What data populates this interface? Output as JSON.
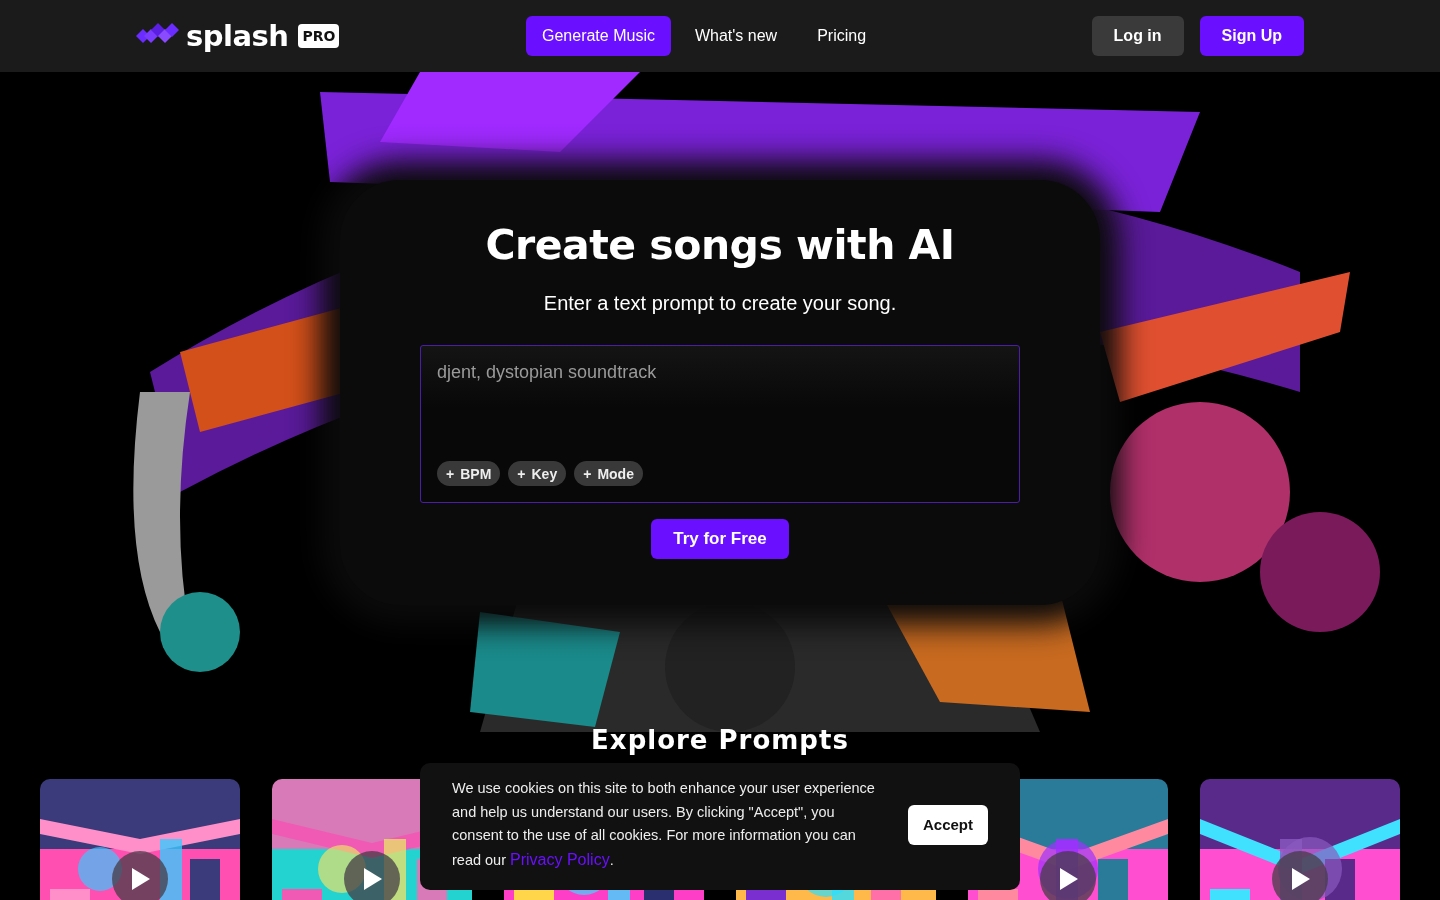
{
  "nav": {
    "logo_text": "splash",
    "logo_badge": "PRO",
    "links": [
      {
        "label": "Generate Music",
        "selected": true
      },
      {
        "label": "What's new",
        "selected": false
      },
      {
        "label": "Pricing",
        "selected": false
      }
    ],
    "login": "Log in",
    "signup": "Sign Up"
  },
  "hero": {
    "title": "Create songs with AI",
    "subtitle": "Enter a text prompt to create your song.",
    "prompt": {
      "placeholder": "djent, dystopian soundtrack",
      "chips": [
        {
          "icon": "+",
          "label": "BPM"
        },
        {
          "icon": "+",
          "label": "Key"
        },
        {
          "icon": "+",
          "label": "Mode"
        }
      ]
    },
    "cta": "Try for Free"
  },
  "explore": {
    "title": "Explore Prompts",
    "cards": [
      {
        "kind": "picture",
        "play_button": true
      },
      {
        "kind": "picture",
        "play_button": true
      },
      {
        "kind": "picture",
        "play_button": false
      },
      {
        "kind": "picture",
        "play_button": false
      },
      {
        "kind": "picture",
        "play_button": true
      },
      {
        "kind": "picture",
        "play_button": true
      }
    ]
  },
  "cookie_banner": {
    "text": "We use cookies on this site to both enhance your user experience and help us understand our users. By clicking \"Accept\", you consent to the use of all cookies. For more information you can read our ",
    "link": "Privacy Policy",
    "end": ".",
    "accept": "Accept"
  }
}
